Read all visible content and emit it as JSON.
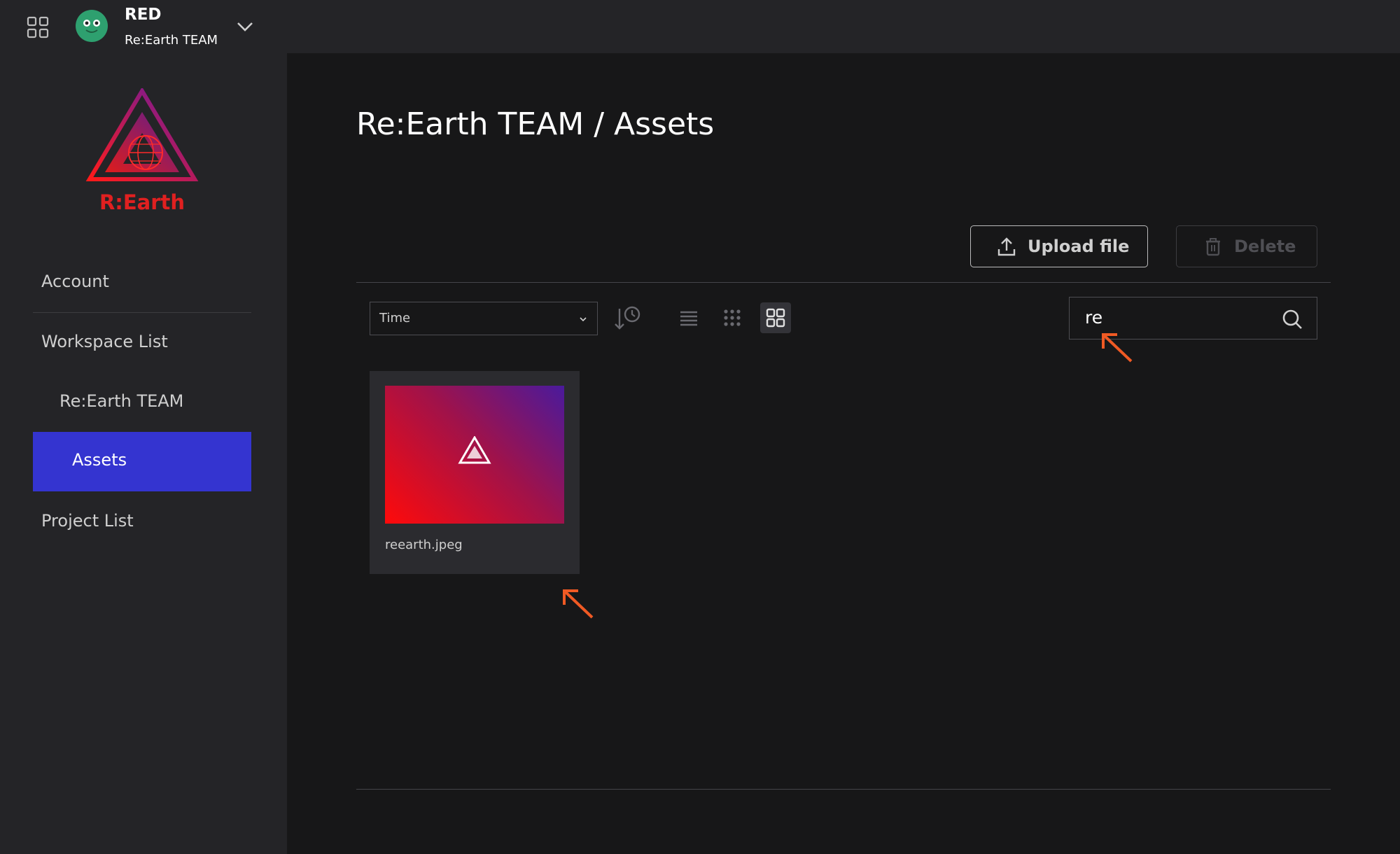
{
  "header": {
    "workspace_name": "RED",
    "workspace_team": "Re:Earth TEAM"
  },
  "sidebar": {
    "logo_text": "R:Earth",
    "items": [
      {
        "label": "Account"
      },
      {
        "label": "Workspace List"
      },
      {
        "label": "Re:Earth TEAM"
      },
      {
        "label": "Assets",
        "active": true
      },
      {
        "label": "Project List"
      }
    ]
  },
  "main": {
    "title": "Re:Earth TEAM / Assets",
    "upload_label": "Upload file",
    "delete_label": "Delete",
    "sort_value": "Time",
    "search_value": "re",
    "assets": [
      {
        "name": "reearth.jpeg"
      }
    ]
  },
  "colors": {
    "accent": "#3434d0",
    "brand_red": "#e02020",
    "annotation_arrow": "#f05a24"
  }
}
